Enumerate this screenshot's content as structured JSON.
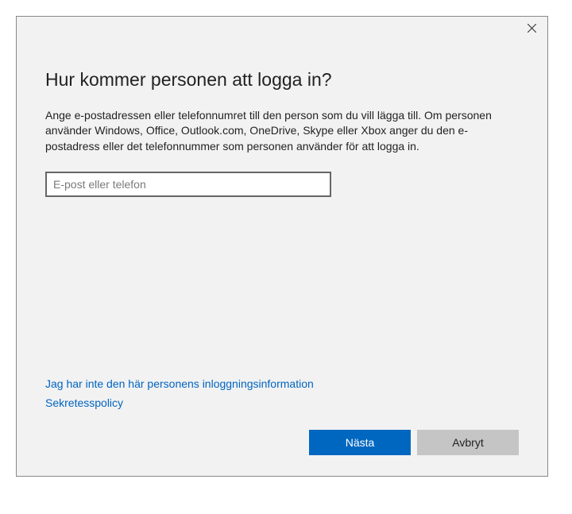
{
  "dialog": {
    "heading": "Hur kommer personen att logga in?",
    "description": "Ange e-postadressen eller telefonnumret till den person som du vill lägga till. Om personen använder Windows, Office, Outlook.com, OneDrive, Skype eller Xbox anger du den e-postadress eller det telefonnummer som personen använder för att logga in.",
    "input": {
      "placeholder": "E-post eller telefon",
      "value": ""
    },
    "links": {
      "no_info": "Jag har inte den här personens inloggningsinformation",
      "privacy": "Sekretesspolicy"
    },
    "buttons": {
      "next": "Nästa",
      "cancel": "Avbryt"
    }
  }
}
